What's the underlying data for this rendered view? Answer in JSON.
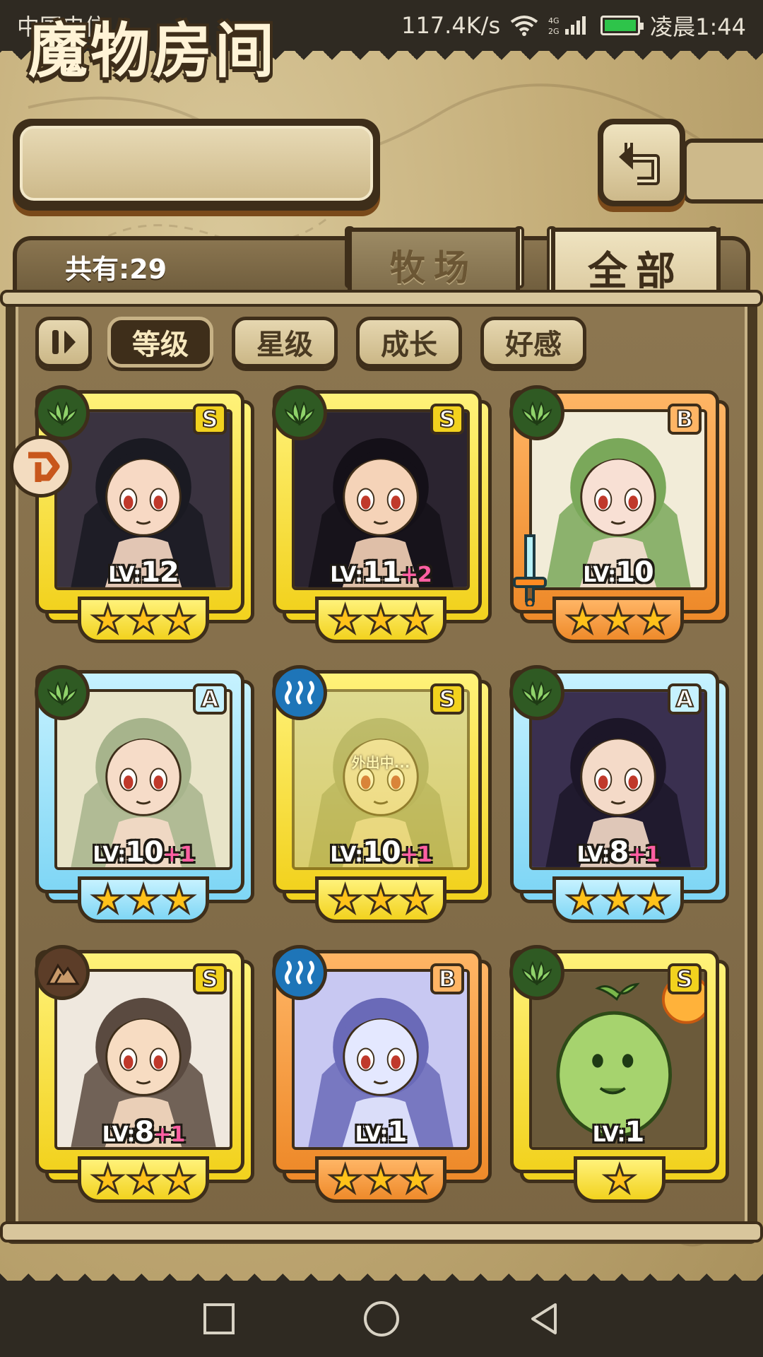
{
  "status_bar": {
    "carrier": "中国电信",
    "speed": "117.4K/s",
    "network": "4G 2G",
    "time": "凌晨1:44"
  },
  "header": {
    "title": "魔物房间",
    "back_icon": "return-arrow-icon"
  },
  "summary": {
    "count_text": "共有:29"
  },
  "tabs": [
    {
      "label": "牧场",
      "active": false
    },
    {
      "label": "全部",
      "active": true
    }
  ],
  "sort_buttons": [
    {
      "label": "等级",
      "active": true
    },
    {
      "label": "星级",
      "active": false
    },
    {
      "label": "成长",
      "active": false
    },
    {
      "label": "好感",
      "active": false
    }
  ],
  "cards": [
    {
      "rank": "S",
      "element": "wood",
      "level": "12",
      "bonus": "",
      "stars": 3,
      "frame": "yellow"
    },
    {
      "rank": "S",
      "element": "wood",
      "level": "11",
      "bonus": "+2",
      "stars": 3,
      "frame": "yellow"
    },
    {
      "rank": "B",
      "element": "wood",
      "level": "10",
      "bonus": "",
      "stars": 3,
      "frame": "orange"
    },
    {
      "rank": "A",
      "element": "wood",
      "level": "10",
      "bonus": "+1",
      "stars": 3,
      "frame": "blue"
    },
    {
      "rank": "S",
      "element": "water",
      "level": "10",
      "bonus": "+1",
      "stars": 3,
      "frame": "yellow",
      "status": "外出中..."
    },
    {
      "rank": "A",
      "element": "wood",
      "level": "8",
      "bonus": "+1",
      "stars": 3,
      "frame": "blue"
    },
    {
      "rank": "S",
      "element": "earth",
      "level": "8",
      "bonus": "+1",
      "stars": 3,
      "frame": "yellow"
    },
    {
      "rank": "B",
      "element": "water",
      "level": "1",
      "bonus": "",
      "stars": 3,
      "frame": "orange"
    },
    {
      "rank": "S",
      "element": "wood",
      "level": "1",
      "bonus": "",
      "stars": 1,
      "frame": "yellow"
    }
  ],
  "level_prefix": "LV:",
  "colors": {
    "frame_yellow": "#f2d21e",
    "frame_orange": "#ee8a2a",
    "frame_blue": "#7fd6f5",
    "outline": "#3e2e1a",
    "star": "#ffc21a",
    "bonus": "#ff5fa2"
  },
  "nav": {
    "buttons": [
      "recent-apps-icon",
      "home-icon",
      "back-icon"
    ]
  }
}
